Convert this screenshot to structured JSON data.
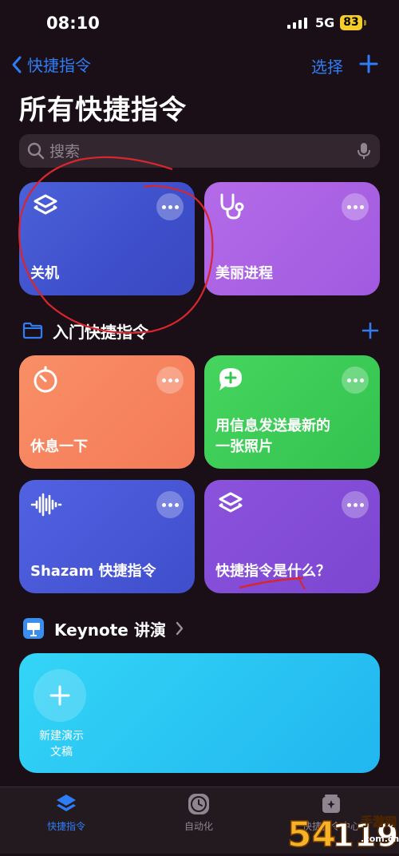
{
  "status_bar": {
    "time": "08:10",
    "network": "5G",
    "battery": "83"
  },
  "nav": {
    "back_label": "快捷指令",
    "select_label": "选择"
  },
  "page_title": "所有快捷指令",
  "search": {
    "placeholder": "搜索"
  },
  "shortcuts_top": [
    {
      "label": "关机",
      "icon": "layers-icon",
      "color": "#4456cf"
    },
    {
      "label": "美丽进程",
      "icon": "stethoscope-icon",
      "color": "#aa62e4"
    }
  ],
  "starter_section": {
    "title": "入门快捷指令"
  },
  "starter_shortcuts": [
    {
      "label": "休息一下",
      "icon": "timer-icon",
      "color": "#f6835e"
    },
    {
      "label": "用信息发送最新的一张照片",
      "label_line1": "用信息发送最新的",
      "label_line2": "一张照片",
      "icon": "message-plus-icon",
      "color": "#3bcb55"
    },
    {
      "label": "Shazam 快捷指令",
      "icon": "waveform-icon",
      "color": "#4858d6"
    },
    {
      "label": "快捷指令是什么？",
      "icon": "layers-icon",
      "color": "#844cd7"
    }
  ],
  "keynote_section": {
    "title": "Keynote 讲演"
  },
  "keynote_card": {
    "label_line1": "新建演示",
    "label_line2": "文稿",
    "color": "#2bc5f3"
  },
  "tab_bar": {
    "tabs": [
      {
        "label": "快捷指令",
        "icon": "layers-icon",
        "active": true
      },
      {
        "label": "自动化",
        "icon": "clock-icon",
        "active": false
      },
      {
        "label": "快捷指令中心",
        "icon": "gallery-icon",
        "active": false
      }
    ]
  },
  "watermark": {
    "text": "54119",
    "subtext": "手游网",
    "domain": ".com.cn"
  },
  "colors": {
    "accent": "#2f7df6",
    "background": "#1a0f16"
  }
}
